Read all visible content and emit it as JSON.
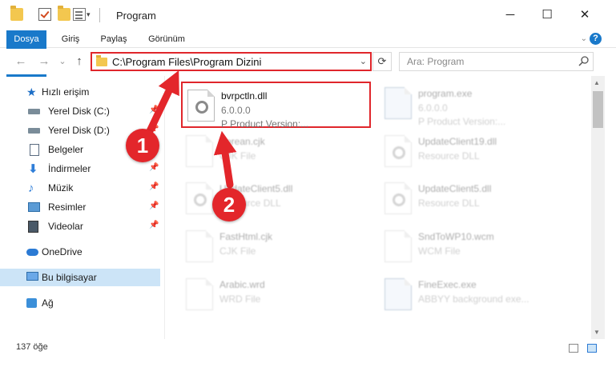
{
  "window": {
    "title": "Program",
    "buttons": {
      "minimize": "─",
      "maximize": "☐",
      "close": "✕"
    }
  },
  "ribbon": {
    "tabs": [
      "Dosya",
      "Giriş",
      "Paylaş",
      "Görünüm"
    ],
    "help": "?",
    "collapse": "⌄"
  },
  "nav": {
    "back": "←",
    "forward": "→",
    "recent": "⌄",
    "up": "↑",
    "address": "C:\\Program Files\\Program Dizini",
    "address_dropdown": "⌄",
    "refresh": "⟳",
    "search_placeholder": "Ara: Program"
  },
  "sidebar": {
    "items": [
      {
        "label": "Hızlı erişim",
        "icon": "star-icon",
        "pinned": false
      },
      {
        "label": "Yerel Disk (C:)",
        "icon": "drive-icon",
        "pinned": true
      },
      {
        "label": "Yerel Disk (D:)",
        "icon": "drive-icon",
        "pinned": true
      },
      {
        "label": "Belgeler",
        "icon": "document-icon",
        "pinned": true
      },
      {
        "label": "İndirmeler",
        "icon": "download-icon",
        "pinned": true
      },
      {
        "label": "Müzik",
        "icon": "music-icon",
        "pinned": true
      },
      {
        "label": "Resimler",
        "icon": "pictures-icon",
        "pinned": true
      },
      {
        "label": "Videolar",
        "icon": "video-icon",
        "pinned": true
      },
      {
        "label": "OneDrive",
        "icon": "cloud-icon",
        "pinned": false
      },
      {
        "label": "Bu bilgisayar",
        "icon": "computer-icon",
        "pinned": false
      },
      {
        "label": "Ağ",
        "icon": "network-icon",
        "pinned": false
      }
    ]
  },
  "files": [
    {
      "name": "bvrpctln.dll",
      "line2": "6.0.0.0",
      "line3": "P  Product Version:...",
      "highlighted": true,
      "icon": "dll-gear-icon"
    },
    {
      "name": "program.exe",
      "line2": "6.0.0.0",
      "line3": "P  Product Version:...",
      "highlighted": false,
      "icon": "exe-icon"
    },
    {
      "name": "Korean.cjk",
      "line2": "CJK File",
      "line3": "",
      "highlighted": false,
      "icon": "file-icon"
    },
    {
      "name": "UpdateClient19.dll",
      "line2": "Resource DLL",
      "line3": "",
      "highlighted": false,
      "icon": "dll-gear-icon"
    },
    {
      "name": "UpdateClient5.dll",
      "line2": "Resource DLL",
      "line3": "",
      "highlighted": false,
      "icon": "dll-gear-icon"
    },
    {
      "name": "UpdateClient5.dll",
      "line2": "Resource DLL",
      "line3": "",
      "highlighted": false,
      "icon": "dll-gear-icon"
    },
    {
      "name": "FastHtml.cjk",
      "line2": "CJK File",
      "line3": "",
      "highlighted": false,
      "icon": "file-icon"
    },
    {
      "name": "SndToWP10.wcm",
      "line2": "WCM File",
      "line3": "",
      "highlighted": false,
      "icon": "file-icon"
    },
    {
      "name": "Arabic.wrd",
      "line2": "WRD File",
      "line3": "",
      "highlighted": false,
      "icon": "file-icon"
    },
    {
      "name": "FineExec.exe",
      "line2": "ABBYY background exe...",
      "line3": "",
      "highlighted": false,
      "icon": "exe-icon"
    }
  ],
  "status": {
    "count": "137 öğe"
  },
  "annotations": [
    {
      "label": "1",
      "color": "#e3262b"
    },
    {
      "label": "2",
      "color": "#e3262b"
    }
  ]
}
